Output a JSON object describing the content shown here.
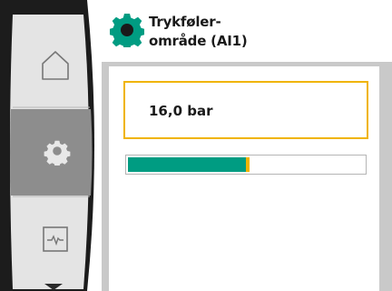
{
  "header": {
    "title_line1": "Trykføler-",
    "title_line2": "område (AI1)",
    "icon": "gear-icon"
  },
  "sidebar": {
    "items": [
      {
        "name": "home",
        "icon": "home-icon",
        "active": false
      },
      {
        "name": "settings",
        "icon": "gear-icon",
        "active": true
      },
      {
        "name": "diagnostics",
        "icon": "pulse-chart-icon",
        "active": false
      }
    ],
    "scroll_indicator": "chevron-down-icon"
  },
  "value": {
    "text": "16,0 bar",
    "level_fraction": 0.5
  },
  "colors": {
    "accent_green": "#009c82",
    "accent_yellow": "#f0b400",
    "sidebar_dark": "#1c1c1c",
    "sidebar_active": "#8d8d8d"
  }
}
